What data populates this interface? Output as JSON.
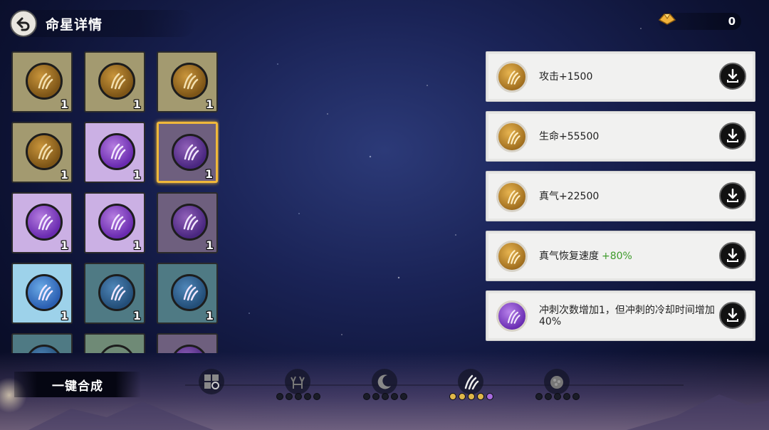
{
  "header": {
    "title": "命星详情"
  },
  "currency": {
    "amount": "0",
    "icon": "gold-ingot-icon"
  },
  "grid": [
    {
      "theme": "gold",
      "count": "1"
    },
    {
      "theme": "gold",
      "count": "1"
    },
    {
      "theme": "gold",
      "count": "1"
    },
    {
      "theme": "gold",
      "count": "1"
    },
    {
      "theme": "purple",
      "count": "1"
    },
    {
      "theme": "dpurple",
      "count": "1",
      "selected": true
    },
    {
      "theme": "purple",
      "count": "1"
    },
    {
      "theme": "purple",
      "count": "1"
    },
    {
      "theme": "dpurple",
      "count": "1"
    },
    {
      "theme": "blue",
      "count": "1"
    },
    {
      "theme": "teal",
      "count": "1"
    },
    {
      "theme": "teal",
      "count": "1"
    },
    {
      "theme": "teal",
      "count": ""
    },
    {
      "theme": "sage",
      "count": ""
    },
    {
      "theme": "dpurple",
      "count": ""
    }
  ],
  "attributes": [
    {
      "orb": "gold",
      "text": "攻击+1500",
      "bonus": ""
    },
    {
      "orb": "gold",
      "text": "生命+55500",
      "bonus": ""
    },
    {
      "orb": "gold",
      "text": "真气+22500",
      "bonus": ""
    },
    {
      "orb": "gold",
      "text": "真气恢复速度",
      "bonus": "+80%"
    },
    {
      "orb": "purple",
      "text": "冲刺次数增加1，但冲刺的冷却时间增加40%",
      "bonus": ""
    }
  ],
  "bottom": {
    "synth_label": "一键合成",
    "tabs": [
      {
        "icon": "grid-icon",
        "dots": []
      },
      {
        "icon": "antler-icon",
        "dots": [
          "off",
          "off",
          "off",
          "off",
          "off"
        ]
      },
      {
        "icon": "crescent-icon",
        "dots": [
          "off",
          "off",
          "off",
          "off",
          "off"
        ]
      },
      {
        "icon": "claw-icon",
        "dots": [
          "y",
          "y",
          "y",
          "y",
          "p"
        ]
      },
      {
        "icon": "stone-icon",
        "dots": [
          "off",
          "off",
          "off",
          "off",
          "off"
        ]
      }
    ]
  },
  "colors": {
    "accent": "#f0b83a",
    "bonus_green": "#3d9b2a"
  }
}
